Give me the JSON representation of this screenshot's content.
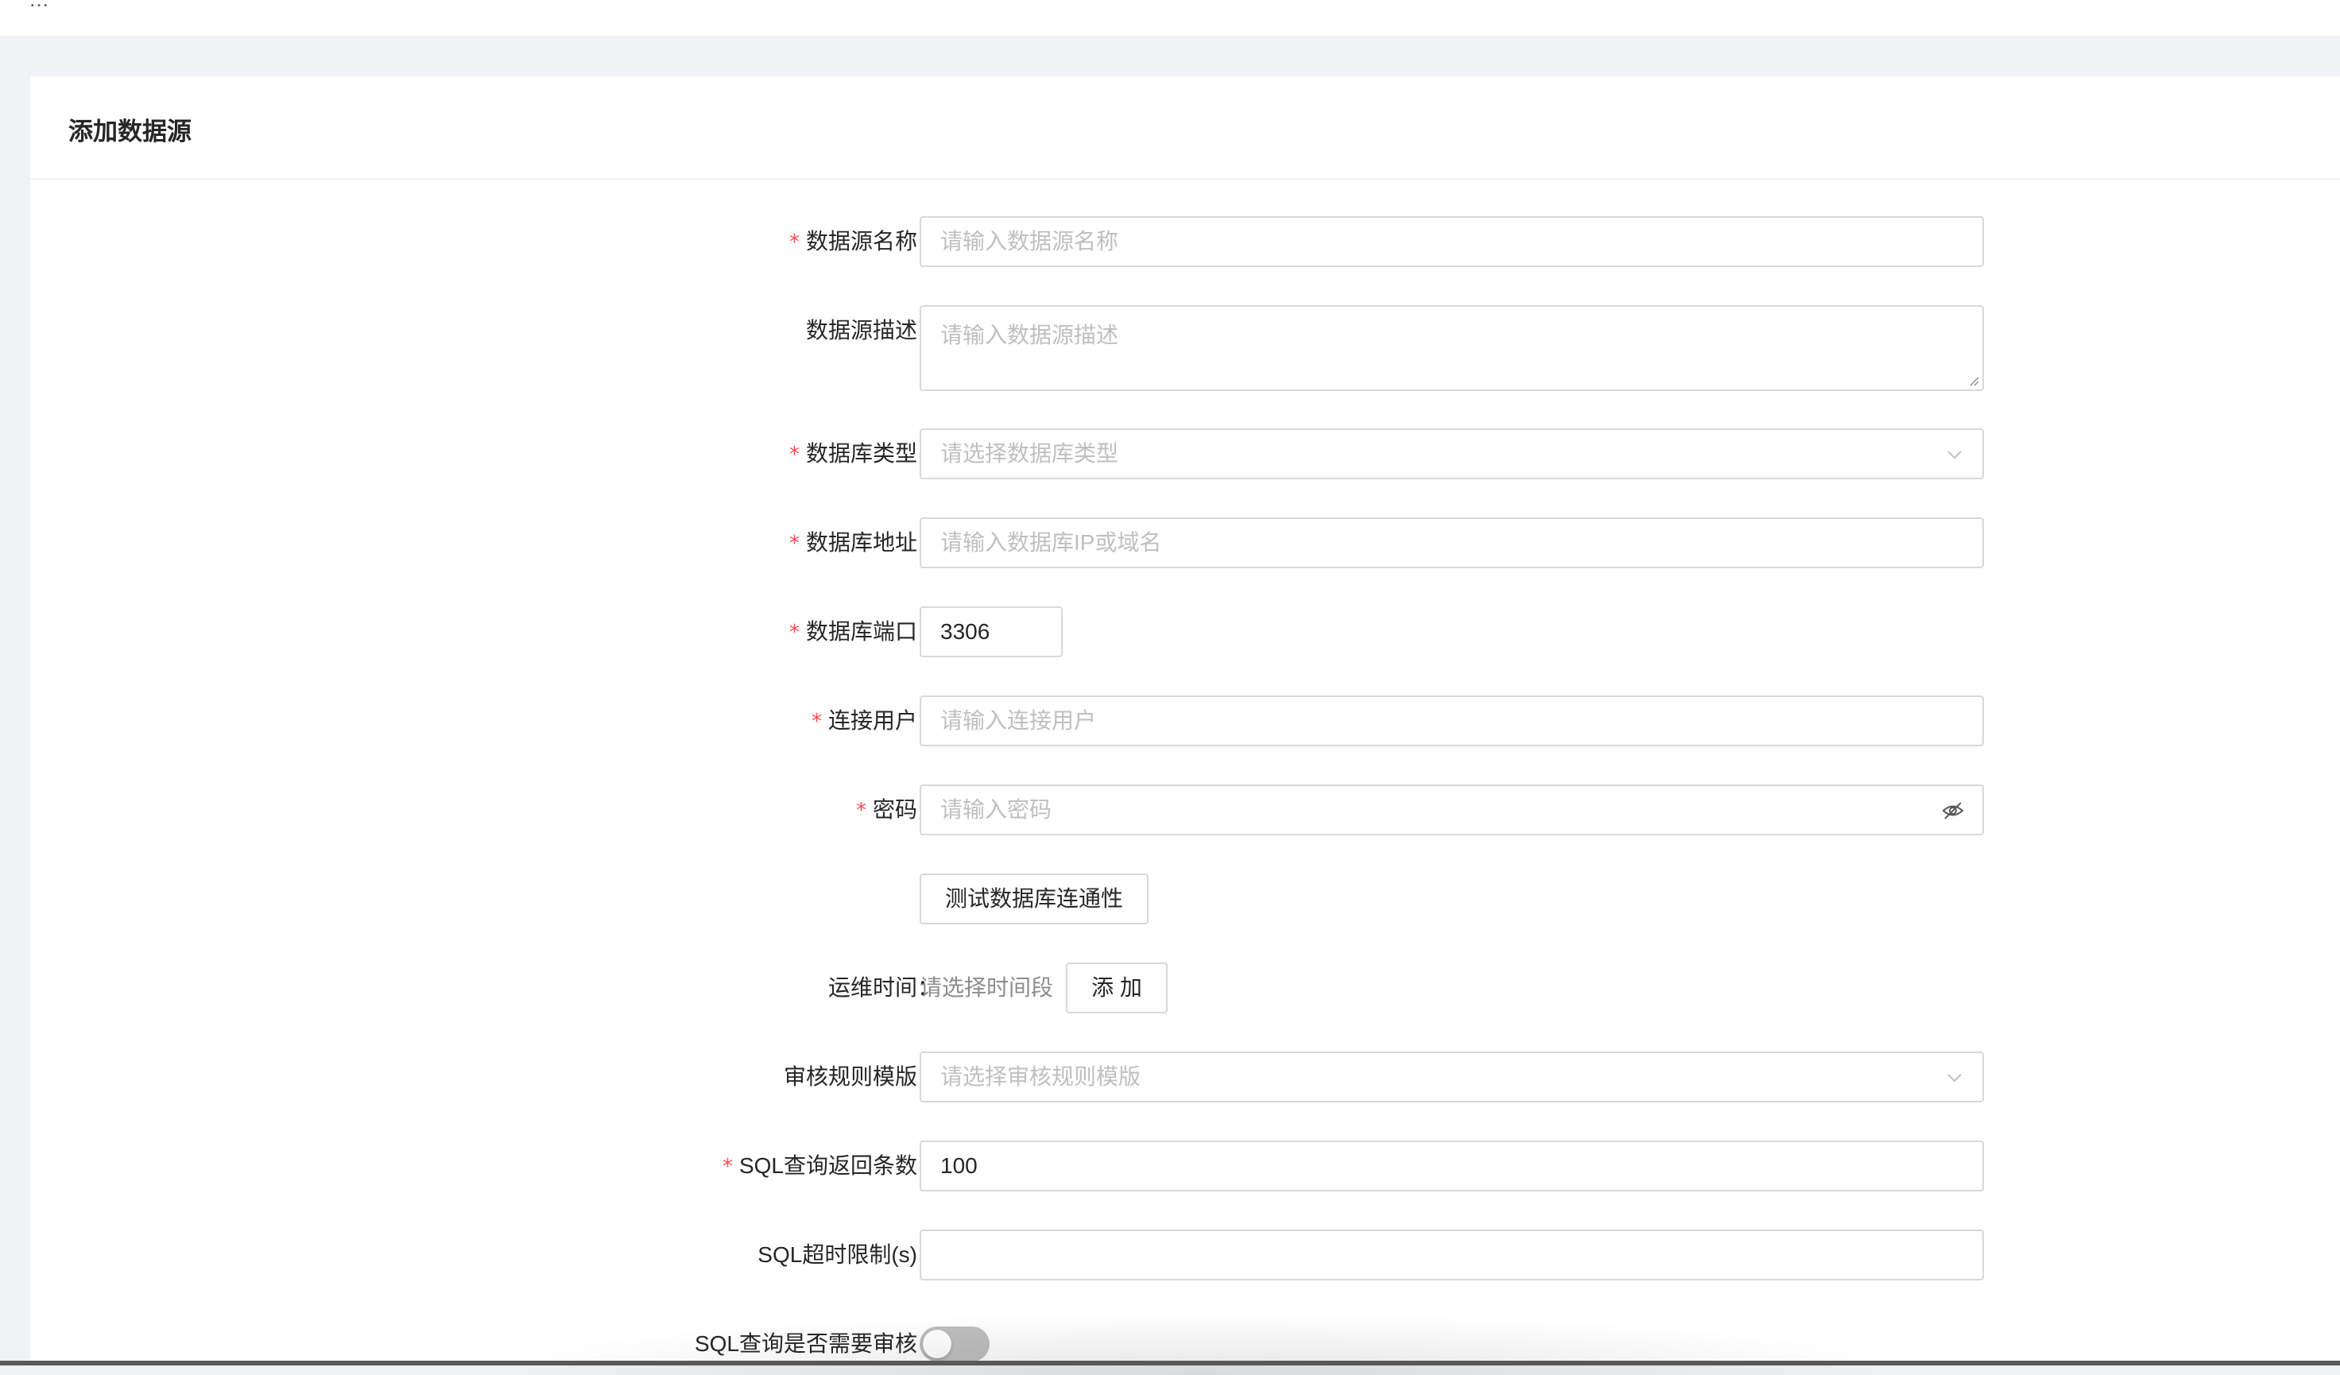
{
  "topbar": {
    "notice": "…"
  },
  "card": {
    "title": "添加数据源"
  },
  "form": {
    "name": {
      "label": "数据源名称",
      "required": true,
      "placeholder": "请输入数据源名称"
    },
    "description": {
      "label": "数据源描述",
      "required": false,
      "placeholder": "请输入数据源描述"
    },
    "db_type": {
      "label": "数据库类型",
      "required": true,
      "placeholder": "请选择数据库类型"
    },
    "host": {
      "label": "数据库地址",
      "required": true,
      "placeholder": "请输入数据库IP或域名"
    },
    "port": {
      "label": "数据库端口",
      "required": true,
      "value": "3306"
    },
    "user": {
      "label": "连接用户",
      "required": true,
      "placeholder": "请输入连接用户"
    },
    "password": {
      "label": "密码",
      "required": true,
      "placeholder": "请输入密码"
    },
    "test_button": "测试数据库连通性",
    "ops_time": {
      "label": "运维时间",
      "hint": "请选择时间段",
      "add_button": "添 加"
    },
    "audit_template": {
      "label": "审核规则模版",
      "required": false,
      "placeholder": "请选择审核规则模版"
    },
    "sql_limit": {
      "label": "SQL查询返回条数",
      "required": true,
      "value": "100"
    },
    "sql_timeout": {
      "label": "SQL超时限制(s)",
      "required": false,
      "value": ""
    },
    "sql_audit": {
      "label": "SQL查询是否需要审核",
      "required": false,
      "enabled": false
    }
  },
  "colon": "：",
  "required_mark": "*",
  "icons": {
    "select": "chevron-down-icon",
    "password": "eye-invisible-icon"
  },
  "colors": {
    "required": "#ff4d4f",
    "border": "#d9d9d9",
    "placeholder": "#bfbfbf",
    "switch_off": "#bfbfbf"
  }
}
